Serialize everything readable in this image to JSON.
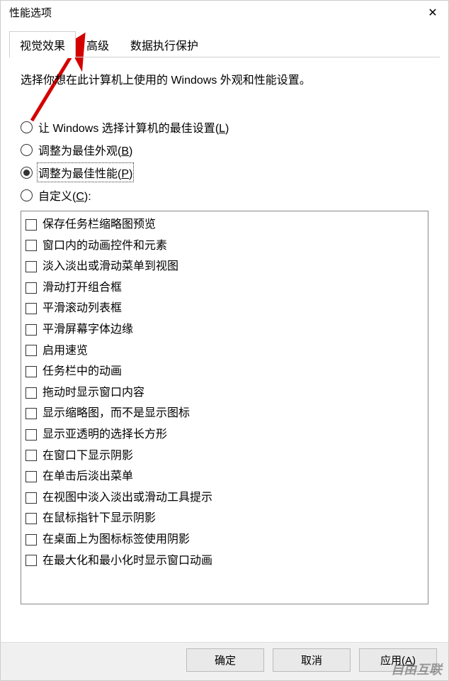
{
  "window": {
    "title": "性能选项"
  },
  "tabs": [
    {
      "label": "视觉效果",
      "active": true
    },
    {
      "label": "高级",
      "active": false
    },
    {
      "label": "数据执行保护",
      "active": false
    }
  ],
  "description": "选择你想在此计算机上使用的 Windows 外观和性能设置。",
  "radios": [
    {
      "label": "让 Windows 选择计算机的最佳设置",
      "accel": "L",
      "checked": false,
      "focused": false
    },
    {
      "label": "调整为最佳外观",
      "accel": "B",
      "checked": false,
      "focused": false
    },
    {
      "label": "调整为最佳性能",
      "accel": "P",
      "checked": true,
      "focused": true
    },
    {
      "label": "自定义",
      "accel": "C",
      "suffix": ":",
      "checked": false,
      "focused": false
    }
  ],
  "checkboxes": [
    "保存任务栏缩略图预览",
    "窗口内的动画控件和元素",
    "淡入淡出或滑动菜单到视图",
    "滑动打开组合框",
    "平滑滚动列表框",
    "平滑屏幕字体边缘",
    "启用速览",
    "任务栏中的动画",
    "拖动时显示窗口内容",
    "显示缩略图，而不是显示图标",
    "显示亚透明的选择长方形",
    "在窗口下显示阴影",
    "在单击后淡出菜单",
    "在视图中淡入淡出或滑动工具提示",
    "在鼠标指针下显示阴影",
    "在桌面上为图标标签使用阴影",
    "在最大化和最小化时显示窗口动画"
  ],
  "buttons": {
    "ok": "确定",
    "cancel": "取消",
    "apply": "应用",
    "apply_accel": "A"
  },
  "watermark": "自由互联"
}
